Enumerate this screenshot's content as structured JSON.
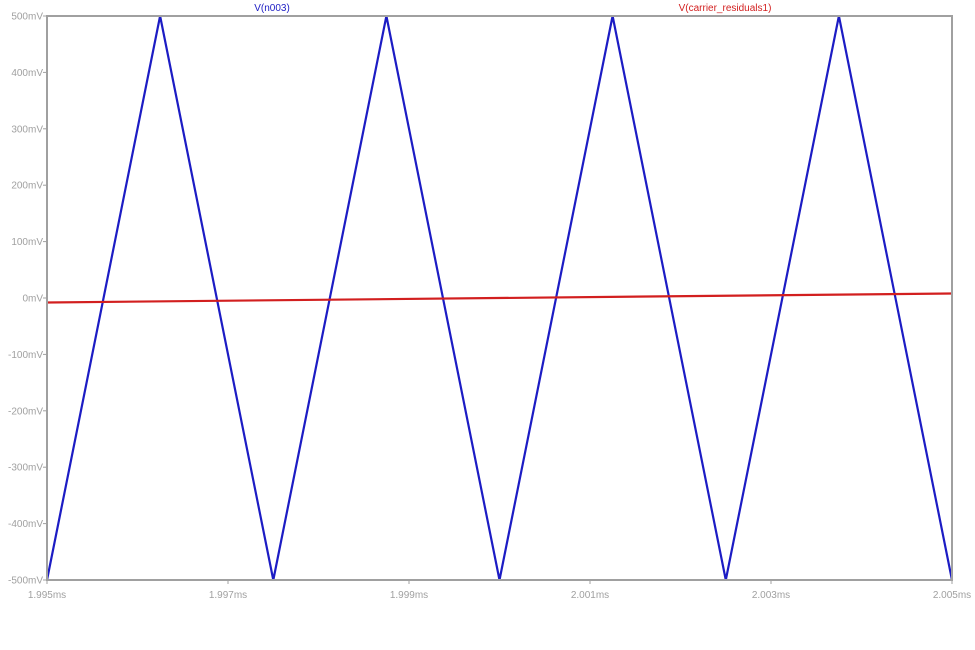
{
  "chart_data": {
    "type": "line",
    "title": "",
    "xlabel": "",
    "ylabel": "",
    "xlim": [
      1.995,
      2.005
    ],
    "ylim": [
      -500,
      500
    ],
    "x_unit": "ms",
    "y_unit": "mV",
    "grid": false,
    "xticks": [
      {
        "value": 1.995,
        "label": "1.995ms"
      },
      {
        "value": 1.997,
        "label": "1.997ms"
      },
      {
        "value": 1.999,
        "label": "1.999ms"
      },
      {
        "value": 2.001,
        "label": "2.001ms"
      },
      {
        "value": 2.003,
        "label": "2.003ms"
      },
      {
        "value": 2.005,
        "label": "2.005ms"
      }
    ],
    "yticks": [
      {
        "value": 500,
        "label": "500mV"
      },
      {
        "value": 400,
        "label": "400mV"
      },
      {
        "value": 300,
        "label": "300mV"
      },
      {
        "value": 200,
        "label": "200mV"
      },
      {
        "value": 100,
        "label": "100mV"
      },
      {
        "value": 0,
        "label": "0mV"
      },
      {
        "value": -100,
        "label": "-100mV"
      },
      {
        "value": -200,
        "label": "-200mV"
      },
      {
        "value": -300,
        "label": "-300mV"
      },
      {
        "value": -400,
        "label": "-400mV"
      },
      {
        "value": -500,
        "label": "-500mV"
      }
    ],
    "series": [
      {
        "name": "V(n003)",
        "color": "#1c1cc4",
        "x": [
          1.995,
          1.99625,
          1.9975,
          1.99875,
          2.0,
          2.00125,
          2.0025,
          2.00375,
          2.005
        ],
        "y": [
          -500,
          500,
          -500,
          500,
          -500,
          500,
          -500,
          500,
          -500
        ]
      },
      {
        "name": "V(carrier_residuals1)",
        "color": "#d21f1f",
        "x": [
          1.995,
          2.005
        ],
        "y": [
          -8,
          8
        ]
      }
    ]
  }
}
